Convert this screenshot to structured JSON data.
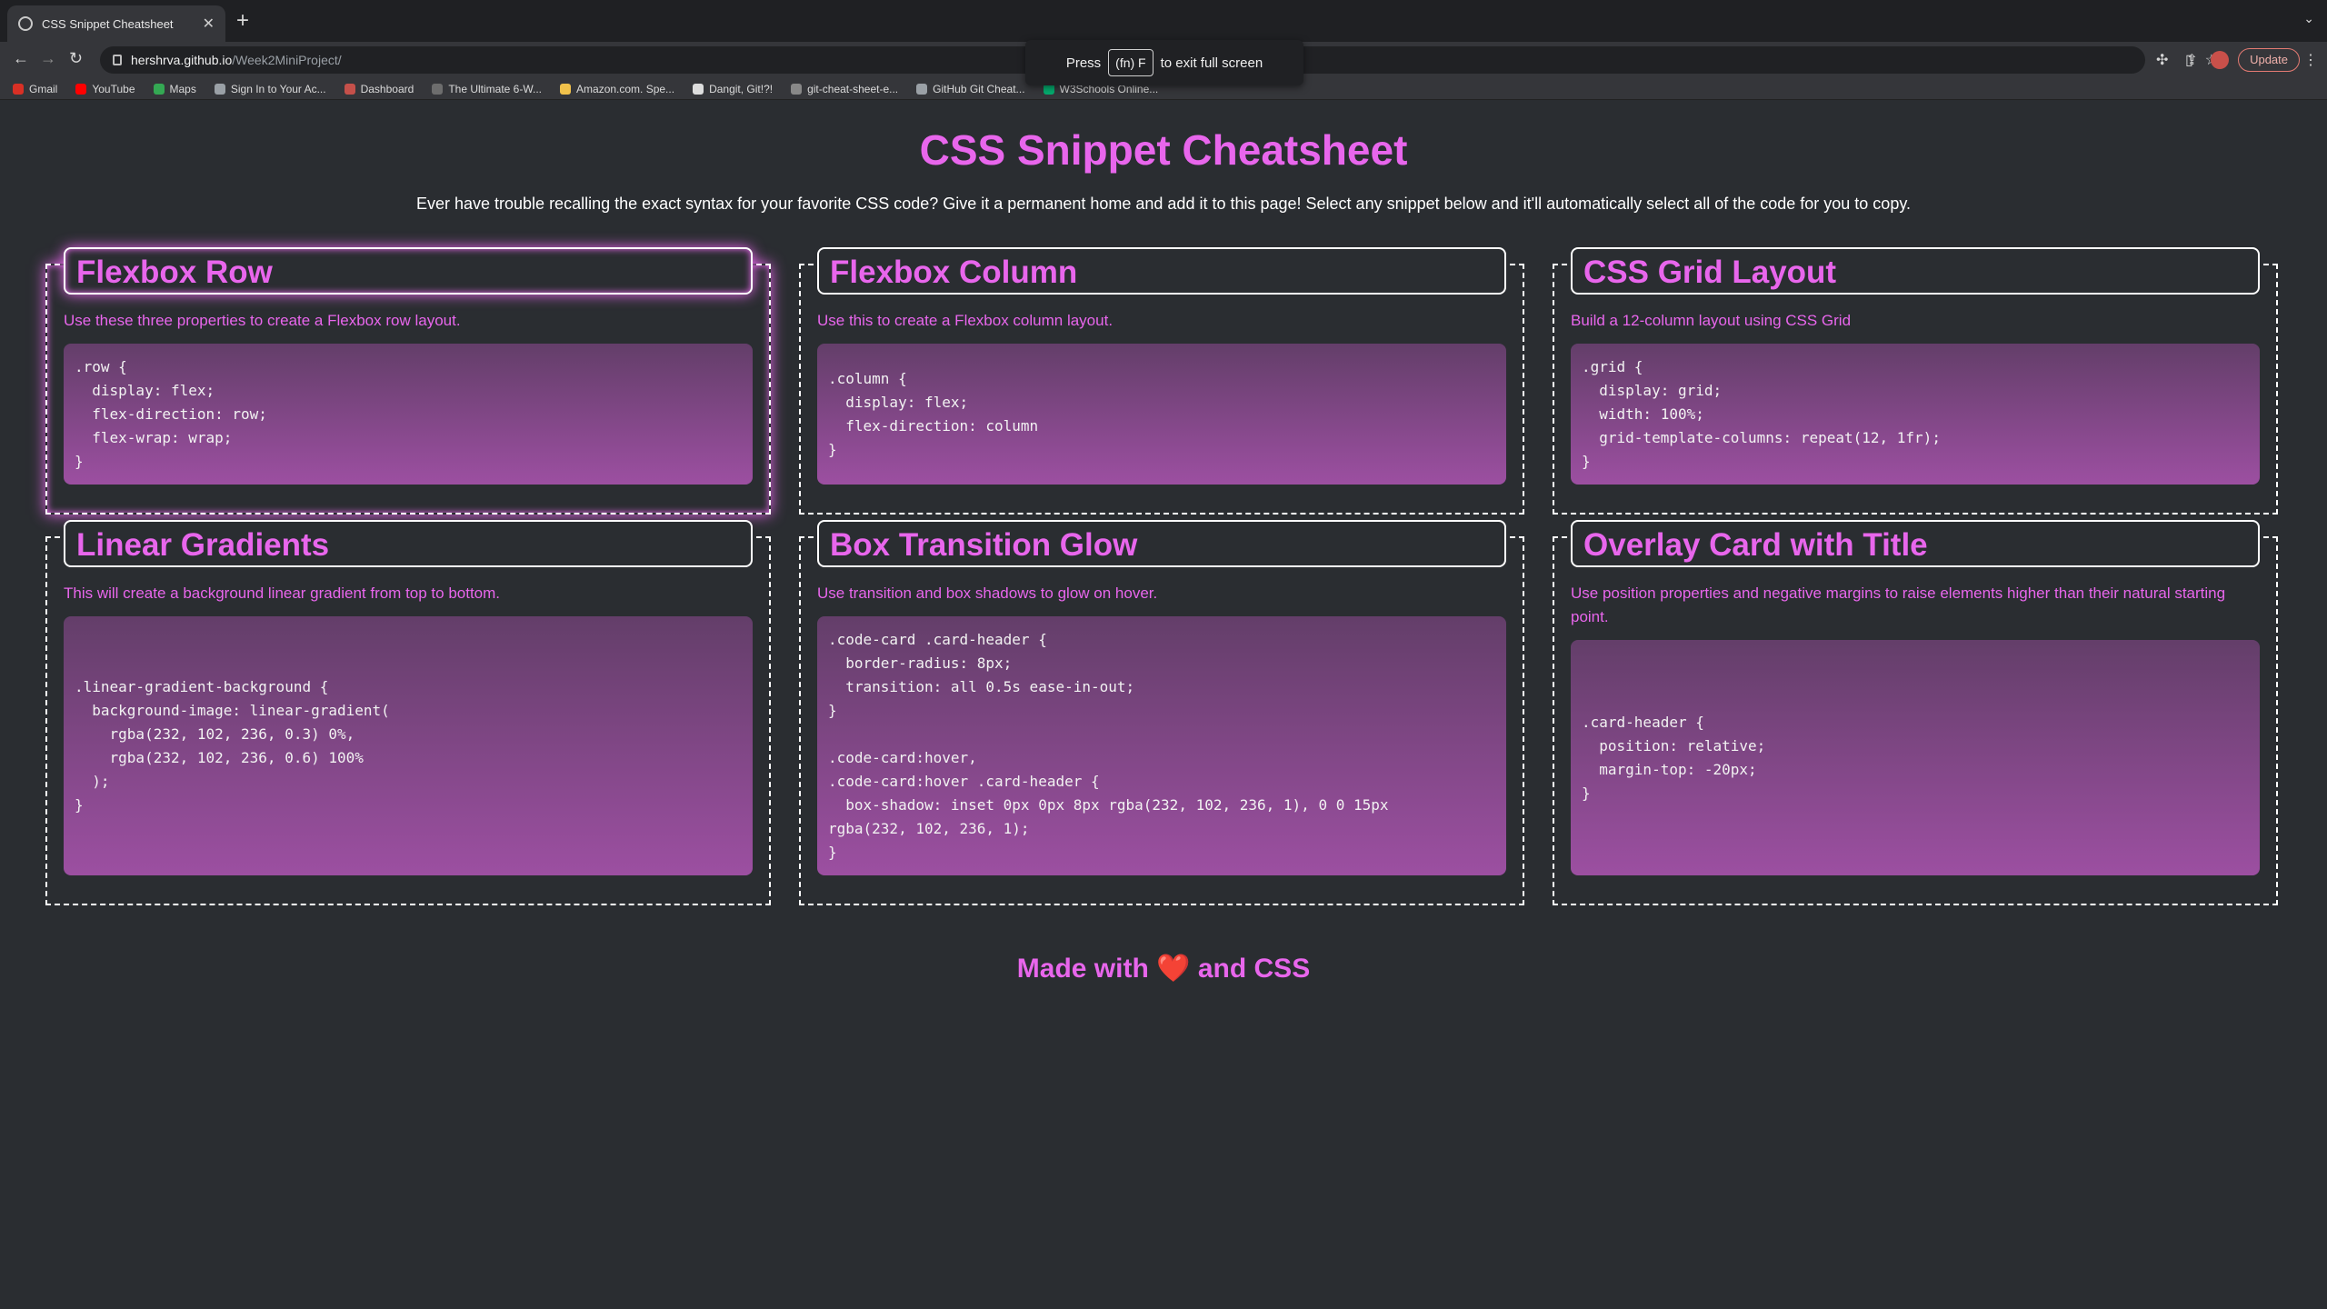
{
  "browser": {
    "tab_title": "CSS Snippet Cheatsheet",
    "url_host": "hershrva.github.io",
    "url_path": "/Week2MiniProject/",
    "update_label": "Update",
    "fullscreen_toast": {
      "press": "Press",
      "key": "(fn) F",
      "rest": "to exit full screen"
    },
    "bookmarks": [
      {
        "label": "Gmail",
        "color": "#d93025"
      },
      {
        "label": "YouTube",
        "color": "#ff0000"
      },
      {
        "label": "Maps",
        "color": "#34a853"
      },
      {
        "label": "Sign In to Your Ac...",
        "color": "#9aa0a6"
      },
      {
        "label": "Dashboard",
        "color": "#c5504a"
      },
      {
        "label": "The Ultimate 6-W...",
        "color": "#6d6d6d"
      },
      {
        "label": "Amazon.com. Spe...",
        "color": "#f0c14b"
      },
      {
        "label": "Dangit, Git!?!",
        "color": "#dddddd"
      },
      {
        "label": "git-cheat-sheet-e...",
        "color": "#888888"
      },
      {
        "label": "GitHub Git Cheat...",
        "color": "#9aa0a6"
      },
      {
        "label": "W3Schools Online...",
        "color": "#04aa6d"
      }
    ]
  },
  "page": {
    "title": "CSS Snippet Cheatsheet",
    "intro": "Ever have trouble recalling the exact syntax for your favorite CSS code? Give it a permanent home and add it to this page! Select any snippet below and it'll automatically select all of the code for you to copy.",
    "footer_before": "Made with",
    "footer_heart": "❤️",
    "footer_after": "and CSS",
    "accent_color": "#e866ec",
    "background_color": "#2a2d31"
  },
  "cards": [
    {
      "title": "Flexbox Row",
      "description": "Use these three properties to create a Flexbox row layout.",
      "code": ".row {\n  display: flex;\n  flex-direction: row;\n  flex-wrap: wrap;\n}"
    },
    {
      "title": "Flexbox Column",
      "description": "Use this to create a Flexbox column layout.",
      "code": ".column {\n  display: flex;\n  flex-direction: column\n}"
    },
    {
      "title": "CSS Grid Layout",
      "description": "Build a 12-column layout using CSS Grid",
      "code": ".grid {\n  display: grid;\n  width: 100%;\n  grid-template-columns: repeat(12, 1fr);\n}"
    },
    {
      "title": "Linear Gradients",
      "description": "This will create a background linear gradient from top to bottom.",
      "code": ".linear-gradient-background {\n  background-image: linear-gradient(\n    rgba(232, 102, 236, 0.3) 0%,\n    rgba(232, 102, 236, 0.6) 100%\n  );\n}"
    },
    {
      "title": "Box Transition Glow",
      "description": "Use transition and box shadows to glow on hover.",
      "code": ".code-card .card-header {\n  border-radius: 8px;\n  transition: all 0.5s ease-in-out;\n}\n\n.code-card:hover,\n.code-card:hover .card-header {\n  box-shadow: inset 0px 0px 8px rgba(232, 102, 236, 1), 0 0 15px\nrgba(232, 102, 236, 1);\n}"
    },
    {
      "title": "Overlay Card with Title",
      "description": "Use position properties and negative margins to raise elements higher than their natural starting point.",
      "code": ".card-header {\n  position: relative;\n  margin-top: -20px;\n}"
    }
  ]
}
